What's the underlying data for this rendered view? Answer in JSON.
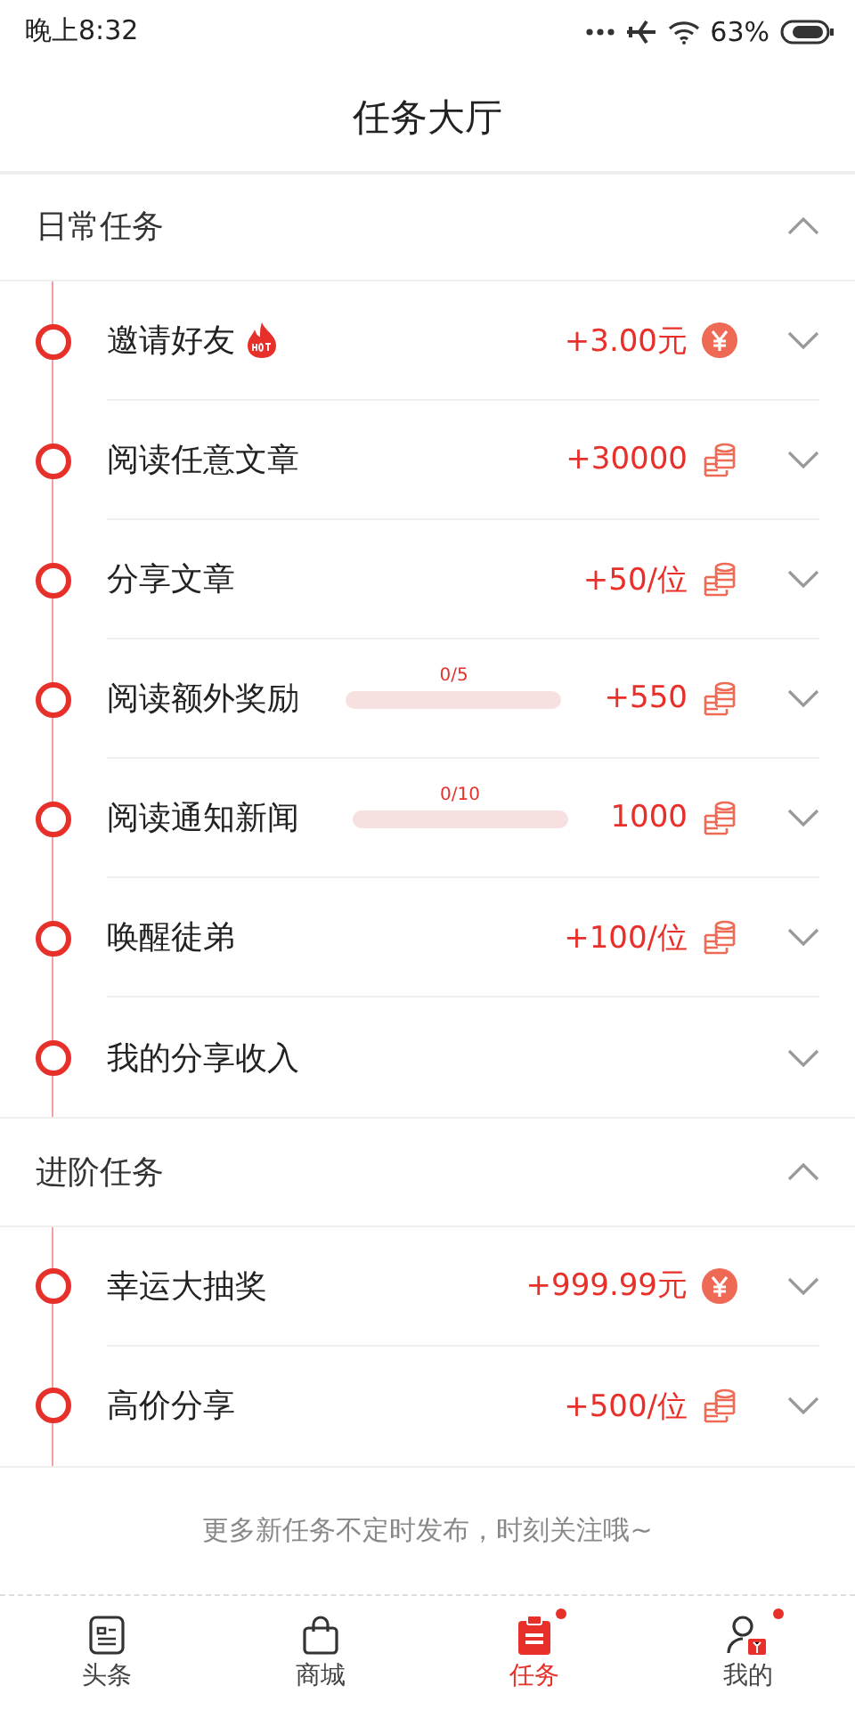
{
  "status_bar": {
    "time": "晚上8:32",
    "battery": "63%"
  },
  "header": {
    "title": "任务大厅"
  },
  "sections": [
    {
      "title": "日常任务",
      "expanded": true,
      "tasks": [
        {
          "kind": "cash",
          "name": "邀请好友",
          "hot": true,
          "reward": "+3.00元"
        },
        {
          "kind": "coin",
          "name": "阅读任意文章",
          "hot": false,
          "reward": "+30000"
        },
        {
          "kind": "coin",
          "name": "分享文章",
          "hot": false,
          "reward": "+50/位"
        },
        {
          "kind": "coin",
          "name": "阅读额外奖励",
          "hot": false,
          "progress": {
            "label": "0/5",
            "level": 0
          },
          "reward": "+550"
        },
        {
          "kind": "coin",
          "name": "阅读通知新闻",
          "hot": false,
          "progress": {
            "label": "0/10",
            "level": 0
          },
          "reward": "1000"
        },
        {
          "kind": "coin",
          "name": "唤醒徒弟",
          "hot": false,
          "reward": "+100/位"
        },
        {
          "kind": "plain",
          "name": "我的分享收入",
          "hot": false
        }
      ]
    },
    {
      "title": "进阶任务",
      "expanded": true,
      "tasks": [
        {
          "kind": "cash",
          "name": "幸运大抽奖",
          "hot": false,
          "reward": "+999.99元"
        },
        {
          "kind": "coin",
          "name": "高价分享",
          "hot": false,
          "reward": "+500/位"
        }
      ]
    }
  ],
  "footer_note": "更多新任务不定时发布，时刻关注哦~",
  "nav": [
    {
      "label": "头条",
      "selected": false,
      "dot": false
    },
    {
      "label": "商城",
      "selected": false,
      "dot": false
    },
    {
      "label": "任务",
      "selected": true,
      "dot": true
    },
    {
      "label": "我的",
      "selected": false,
      "dot": true
    }
  ]
}
